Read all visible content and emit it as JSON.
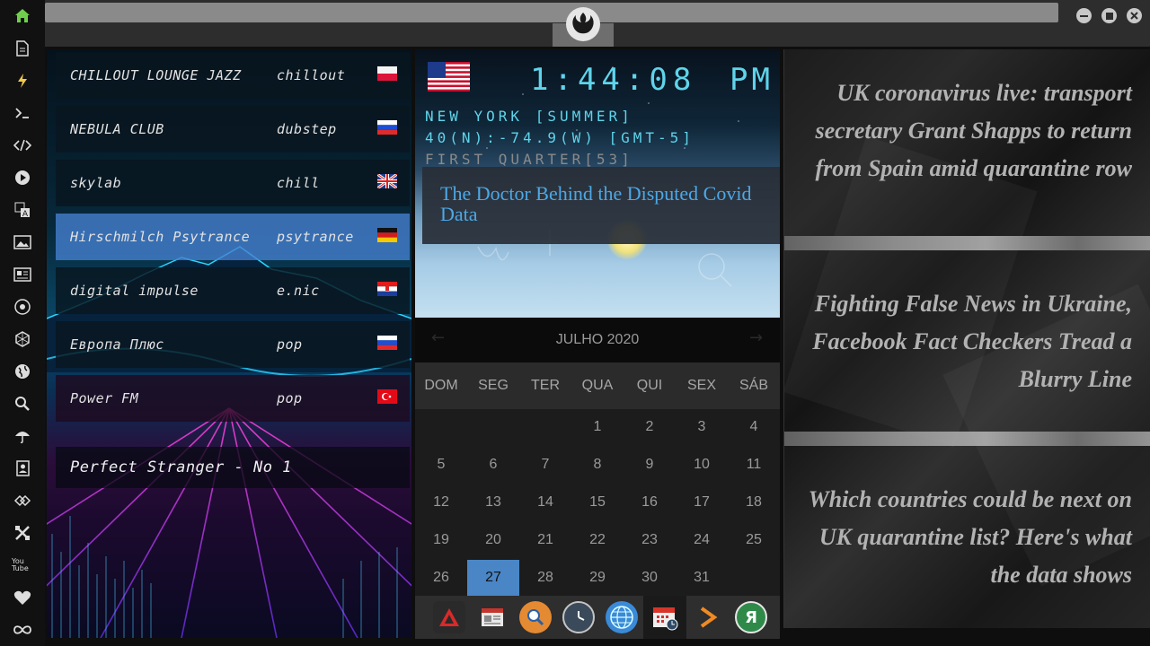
{
  "sidebar": {
    "icons": [
      "home-icon",
      "document-icon",
      "lightning-icon",
      "terminal-icon",
      "code-icon",
      "play-icon",
      "translate-icon",
      "image-icon",
      "news-icon",
      "rebel-icon",
      "hexagon-icon",
      "globe-icon",
      "search-icon",
      "umbrella-icon",
      "contacts-icon",
      "tag-icon",
      "tools-icon",
      "youtube-icon",
      "heart-icon",
      "infinity-icon"
    ],
    "youtube_label": "You Tube",
    "accent": "#6fcf4c"
  },
  "radio": {
    "stations": [
      {
        "name": "CHILLOUT LOUNGE JAZZ",
        "genre": "chillout",
        "flag": "poland"
      },
      {
        "name": "NEBULA CLUB",
        "genre": "dubstep",
        "flag": "russia"
      },
      {
        "name": "skylab",
        "genre": "chill",
        "flag": "uk"
      },
      {
        "name": "Hirschmilch Psytrance",
        "genre": "psytrance",
        "flag": "germany"
      },
      {
        "name": "digital impulse",
        "genre": "e.nic",
        "flag": "croatia"
      },
      {
        "name": "Европа Плюс",
        "genre": "pop",
        "flag": "russia"
      },
      {
        "name": "Power FM",
        "genre": "pop",
        "flag": "turkey"
      }
    ],
    "now_playing": "Perfect Stranger - No 1",
    "selected_color": "#4682d2"
  },
  "clock": {
    "time": "1:44:08",
    "ampm": "PM",
    "location": "NEW YORK [SUMMER]",
    "coords": "40(N):-74.9(W) [GMT-5]",
    "moon": "FIRST QUARTER[53]",
    "headline": "The Doctor Behind the Disputed Covid Data",
    "clock_color": "#5fd4ea",
    "location_color": "#5fd4ea",
    "moon_color": "#8a8a8a"
  },
  "calendar": {
    "month": "JULHO 2020",
    "weekdays": [
      "DOM",
      "SEG",
      "TER",
      "QUA",
      "QUI",
      "SEX",
      "SÁB"
    ],
    "weeks": [
      [
        "",
        "",
        "",
        "1",
        "2",
        "3",
        "4"
      ],
      [
        "5",
        "6",
        "7",
        "8",
        "9",
        "10",
        "11"
      ],
      [
        "12",
        "13",
        "14",
        "15",
        "16",
        "17",
        "18"
      ],
      [
        "19",
        "20",
        "21",
        "22",
        "23",
        "24",
        "25"
      ],
      [
        "26",
        "27",
        "28",
        "29",
        "30",
        "31",
        ""
      ]
    ],
    "today": "27",
    "today_color": "#4a86c6"
  },
  "dock": {
    "items": [
      "alert-app-icon",
      "news-app-icon",
      "search-app-icon",
      "clock-app-icon",
      "globe-app-icon",
      "calendar-app-icon",
      "forward-app-icon",
      "yandex-app-icon"
    ],
    "yandex_label": "Я"
  },
  "news": {
    "headlines": [
      "UK coronavirus live: transport secretary Grant Shapps to return from Spain amid quarantine row",
      "Fighting False News in Ukraine, Facebook Fact Checkers Tread a Blurry Line",
      "Which countries could be next on UK quarantine list? Here's what the data shows"
    ]
  }
}
